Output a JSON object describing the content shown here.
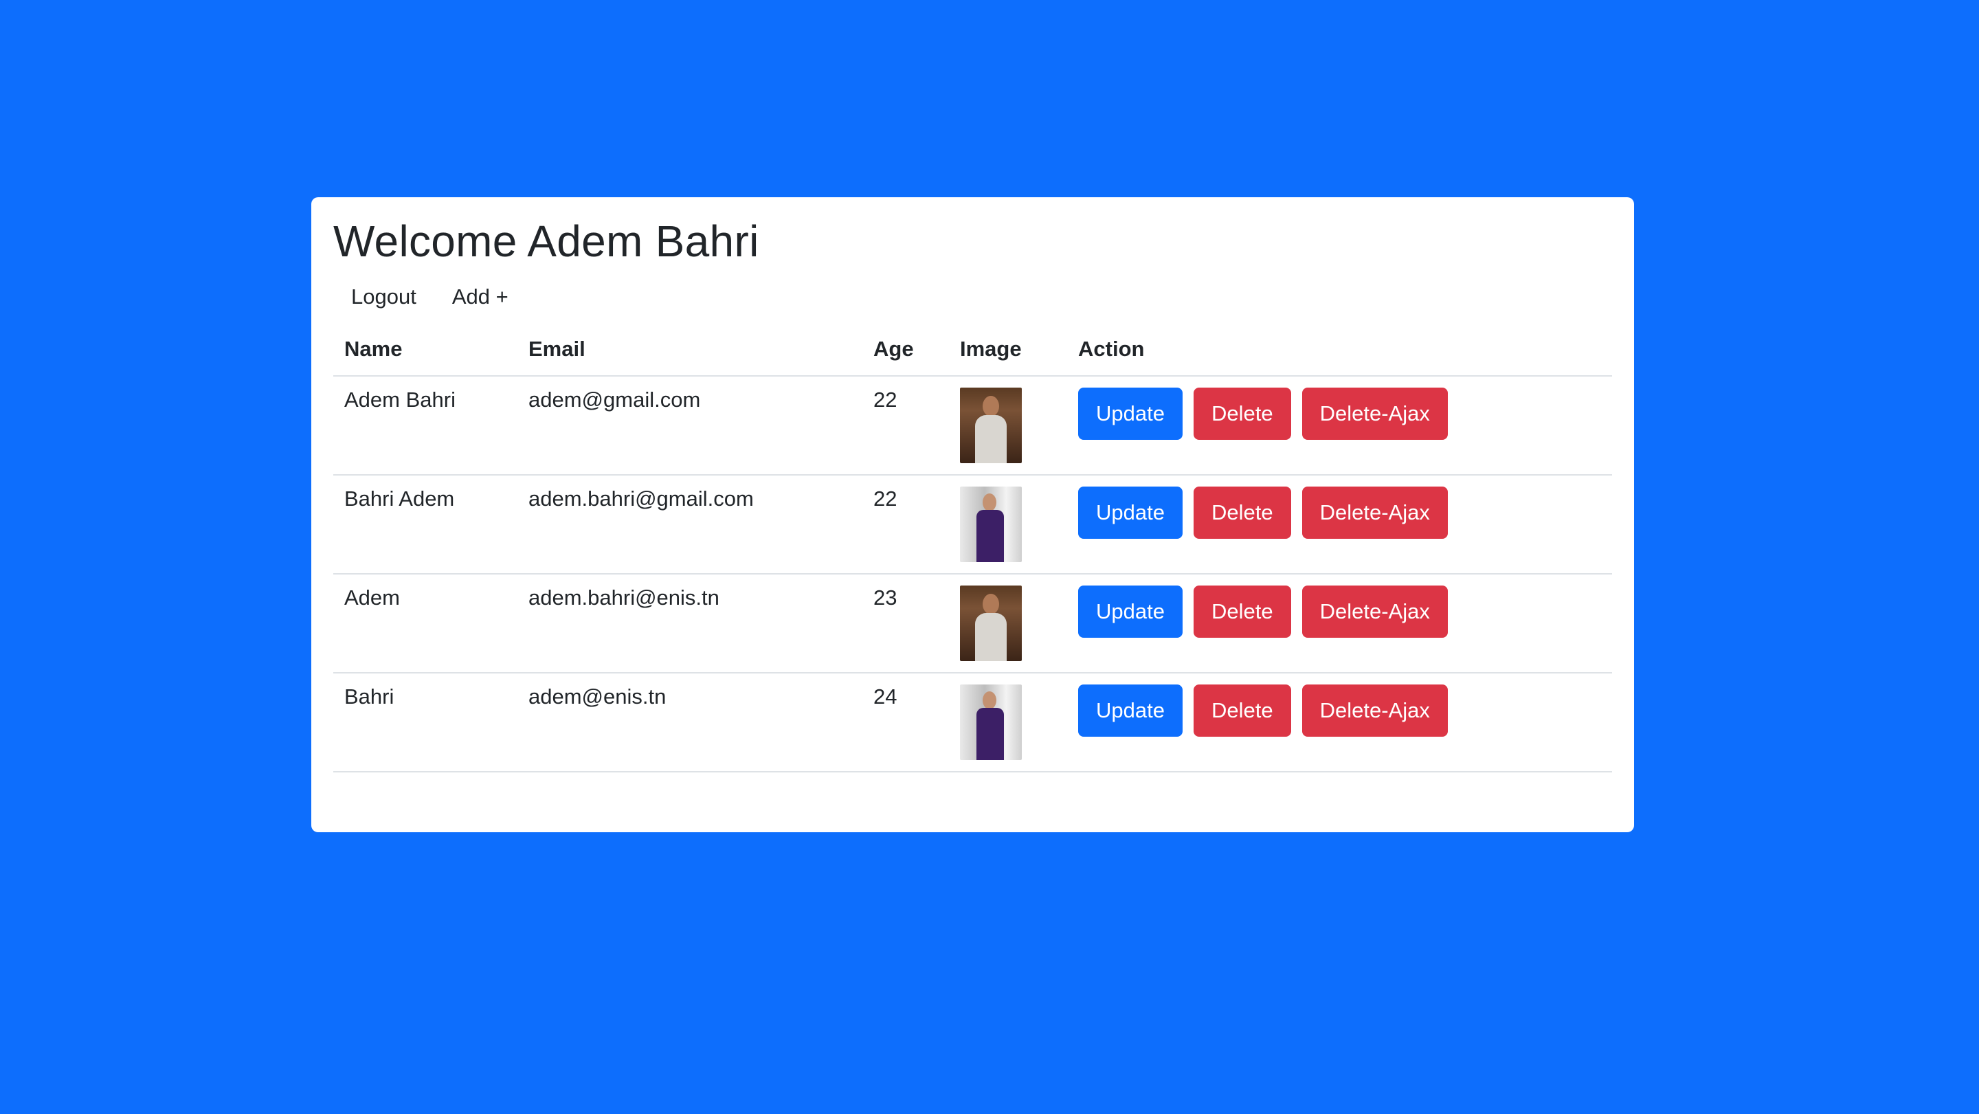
{
  "page": {
    "title": "Welcome Adem Bahri"
  },
  "nav": {
    "logout_label": "Logout",
    "add_label": "Add +"
  },
  "table": {
    "headers": {
      "name": "Name",
      "email": "Email",
      "age": "Age",
      "image": "Image",
      "action": "Action"
    },
    "rows": [
      {
        "name": "Adem Bahri",
        "email": "adem@gmail.com",
        "age": "22",
        "image": "portrait-white-shirt"
      },
      {
        "name": "Bahri Adem",
        "email": "adem.bahri@gmail.com",
        "age": "22",
        "image": "portrait-purple-suit"
      },
      {
        "name": "Adem",
        "email": "adem.bahri@enis.tn",
        "age": "23",
        "image": "portrait-white-shirt"
      },
      {
        "name": "Bahri",
        "email": "adem@enis.tn",
        "age": "24",
        "image": "portrait-purple-suit"
      }
    ]
  },
  "actions": {
    "update_label": "Update",
    "delete_label": "Delete",
    "delete_ajax_label": "Delete-Ajax"
  },
  "colors": {
    "background": "#0d6efd",
    "primary": "#0d6efd",
    "danger": "#dc3545",
    "card": "#ffffff"
  }
}
